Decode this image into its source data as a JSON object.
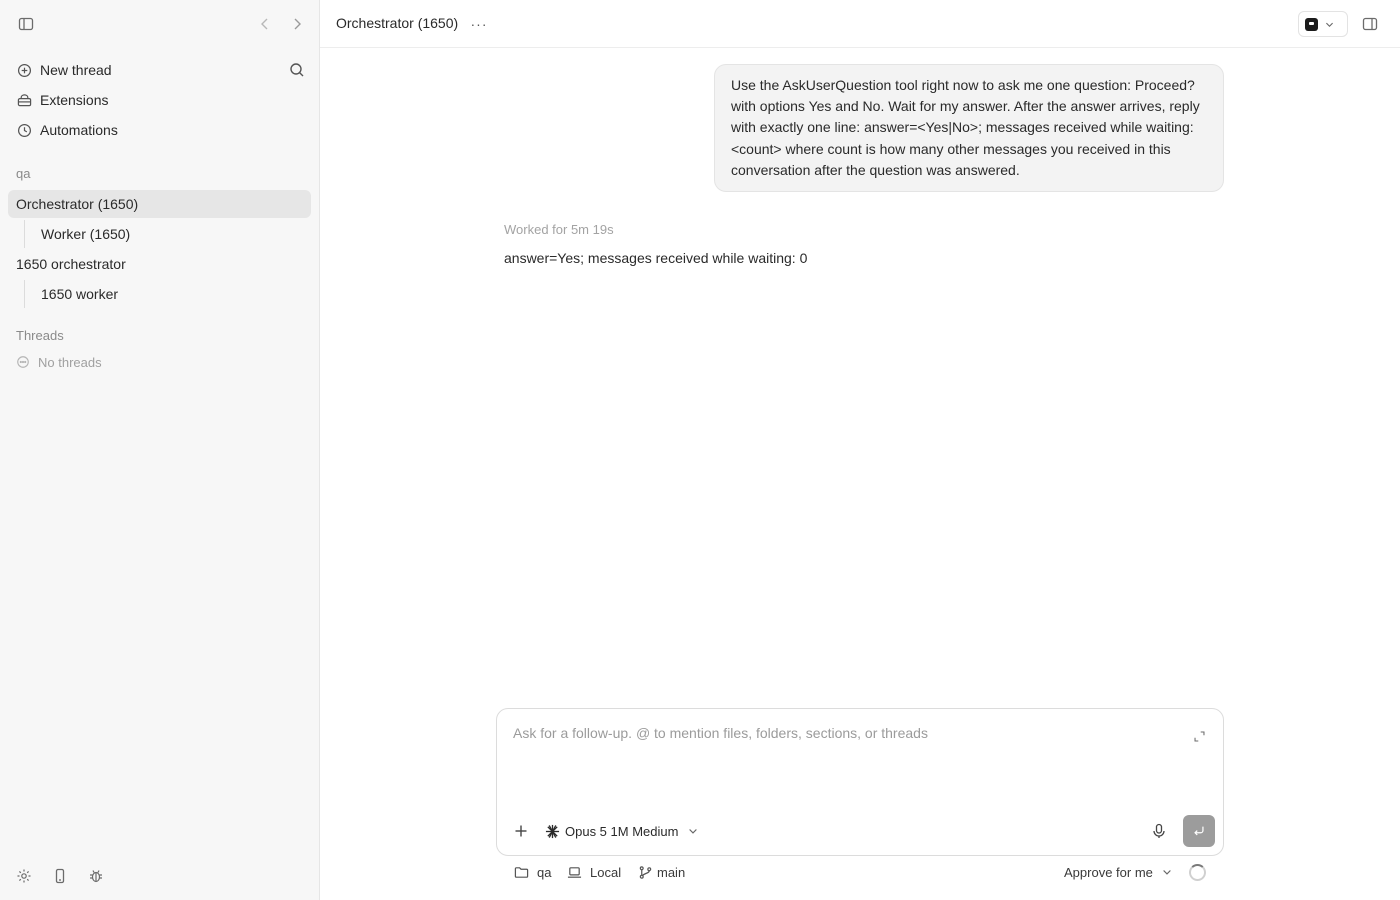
{
  "sidebar": {
    "nav": [
      {
        "label": "New thread",
        "icon": "plus-circle-icon"
      },
      {
        "label": "Extensions",
        "icon": "extensions-icon"
      },
      {
        "label": "Automations",
        "icon": "clock-icon"
      }
    ],
    "project_label": "qa",
    "tree": {
      "orchestrator_1": "Orchestrator (1650)",
      "worker_1": "Worker (1650)",
      "orchestrator_2": "1650 orchestrator",
      "worker_2": "1650 worker"
    },
    "threads_label": "Threads",
    "no_threads": "No threads"
  },
  "header": {
    "title": "Orchestrator (1650)",
    "more": "···"
  },
  "chat": {
    "user_message": "Use the AskUserQuestion tool right now to ask me one question: Proceed? with options Yes and No. Wait for my answer. After the answer arrives, reply with exactly one line: answer=<Yes|No>; messages received while waiting: <count> where count is how many other messages you received in this conversation after the question was answered.",
    "worked": "Worked for 5m 19s",
    "reply": "answer=Yes; messages received while waiting: 0"
  },
  "composer": {
    "placeholder": "Ask for a follow-up. @ to mention files, folders, sections, or threads",
    "value": "",
    "model": "Opus 5 1M Medium"
  },
  "footer": {
    "folder": "qa",
    "environment": "Local",
    "branch": "main",
    "approval": "Approve for me"
  },
  "colors": {
    "sidebar_bg": "#f7f7f7",
    "active_item_bg": "#e6e6e6",
    "send_button": "#9c9c9c"
  }
}
